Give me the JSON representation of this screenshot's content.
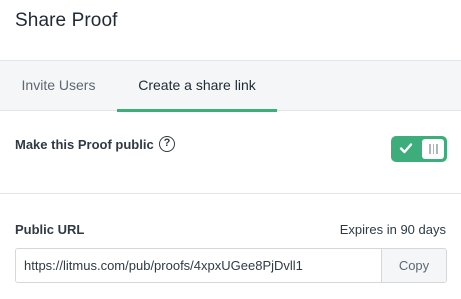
{
  "dialog": {
    "title": "Share Proof"
  },
  "tabs": [
    {
      "label": "Invite Users",
      "active": false
    },
    {
      "label": "Create a share link",
      "active": true
    }
  ],
  "public_setting": {
    "label": "Make this Proof public",
    "help_icon": "question-circle-icon",
    "help_glyph": "?",
    "toggle_on": true,
    "toggle_icon": "check-icon"
  },
  "share_link": {
    "label": "Public URL",
    "expires": "Expires in 90 days",
    "url": "https://litmus.com/pub/proofs/4xpxUGee8PjDvll1",
    "copy_label": "Copy"
  },
  "colors": {
    "accent": "#3dad7c",
    "text": "#2f3a45",
    "tab_background": "#f4f6f7",
    "border": "#e3e6e9"
  }
}
